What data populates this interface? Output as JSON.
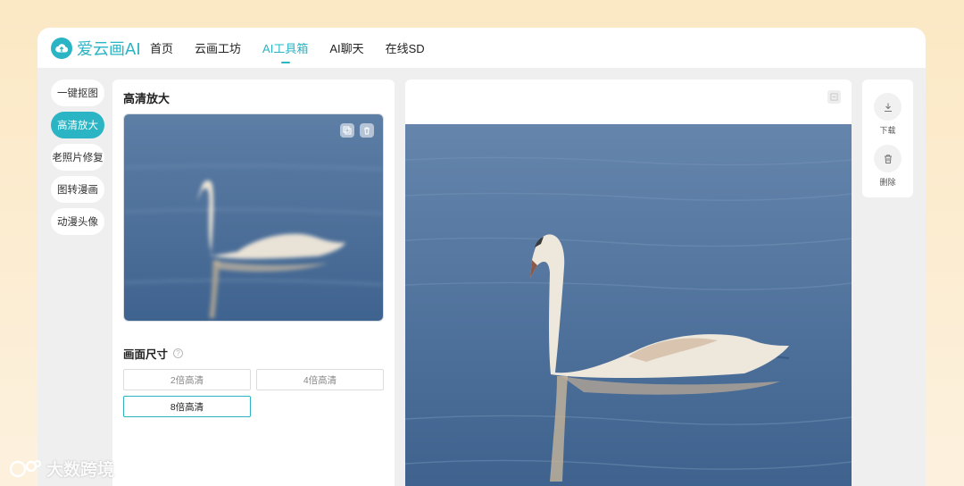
{
  "brand": {
    "name": "爱云画AI",
    "logo_icon": "cloud-icon",
    "color": "#2ab4c4"
  },
  "nav": [
    {
      "label": "首页"
    },
    {
      "label": "云画工坊"
    },
    {
      "label": "AI工具箱",
      "active": true
    },
    {
      "label": "AI聊天"
    },
    {
      "label": "在线SD"
    }
  ],
  "tools": [
    {
      "label": "一键抠图"
    },
    {
      "label": "高清放大",
      "active": true
    },
    {
      "label": "老照片修复"
    },
    {
      "label": "图转漫画"
    },
    {
      "label": "动漫头像"
    }
  ],
  "panel": {
    "title": "高清放大",
    "preview_icons": [
      "replace-icon",
      "trash-icon"
    ],
    "size_title": "画面尺寸",
    "help_icon": "?",
    "options": [
      {
        "label": "2倍高清"
      },
      {
        "label": "4倍高清"
      },
      {
        "label": "8倍高清",
        "selected": true
      }
    ]
  },
  "canvas": {
    "compare_icon": "compare-icon"
  },
  "actions": [
    {
      "label": "下载",
      "icon": "download-icon"
    },
    {
      "label": "删除",
      "icon": "trash-icon"
    }
  ],
  "watermark": {
    "text": "大数跨境"
  }
}
